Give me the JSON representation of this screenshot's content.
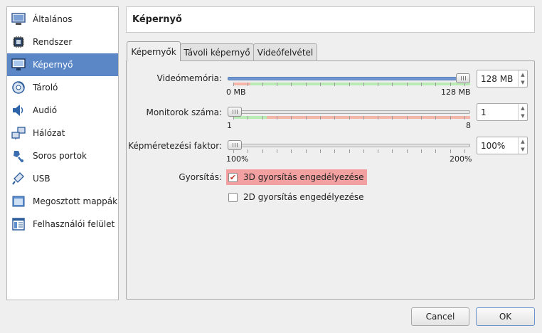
{
  "sidebar": {
    "items": [
      {
        "label": "Általános",
        "icon": "general-icon"
      },
      {
        "label": "Rendszer",
        "icon": "system-chip-icon"
      },
      {
        "label": "Képernyő",
        "icon": "display-monitor-icon",
        "selected": true
      },
      {
        "label": "Tároló",
        "icon": "storage-disk-icon"
      },
      {
        "label": "Audió",
        "icon": "audio-speaker-icon"
      },
      {
        "label": "Hálózat",
        "icon": "network-icon"
      },
      {
        "label": "Soros portok",
        "icon": "serial-port-icon"
      },
      {
        "label": "USB",
        "icon": "usb-icon"
      },
      {
        "label": "Megosztott mappák",
        "icon": "shared-folder-icon"
      },
      {
        "label": "Felhasználói felület",
        "icon": "user-interface-icon"
      }
    ]
  },
  "header": {
    "title": "Képernyő"
  },
  "tabs": [
    {
      "label": "Képernyők",
      "active": true
    },
    {
      "label": "Távoli képernyő",
      "active": false
    },
    {
      "label": "Videófelvétel",
      "active": false
    }
  ],
  "video_memory": {
    "label": "Videómemória:",
    "value": "128 MB",
    "min_label": "0 MB",
    "max_label": "128 MB",
    "fraction": 1.0
  },
  "monitor_count": {
    "label": "Monitorok száma:",
    "value": "1",
    "min_label": "1",
    "max_label": "8",
    "fraction": 0.0
  },
  "scale_factor": {
    "label": "Képméretezési faktor:",
    "value": "100%",
    "min_label": "100%",
    "max_label": "200%",
    "fraction": 0.0
  },
  "acceleration": {
    "label": "Gyorsítás:",
    "accel_3d": {
      "label": "3D gyorsítás engedélyezése",
      "checked": true
    },
    "accel_2d": {
      "label": "2D gyorsítás engedélyezése",
      "checked": false
    }
  },
  "buttons": {
    "cancel": "Cancel",
    "ok": "OK"
  },
  "colors": {
    "selection": "#5b87c7",
    "ok_zone": "#b9ecb4",
    "warn_zone": "#f3b6a8",
    "highlight": "#f2a0a0"
  }
}
